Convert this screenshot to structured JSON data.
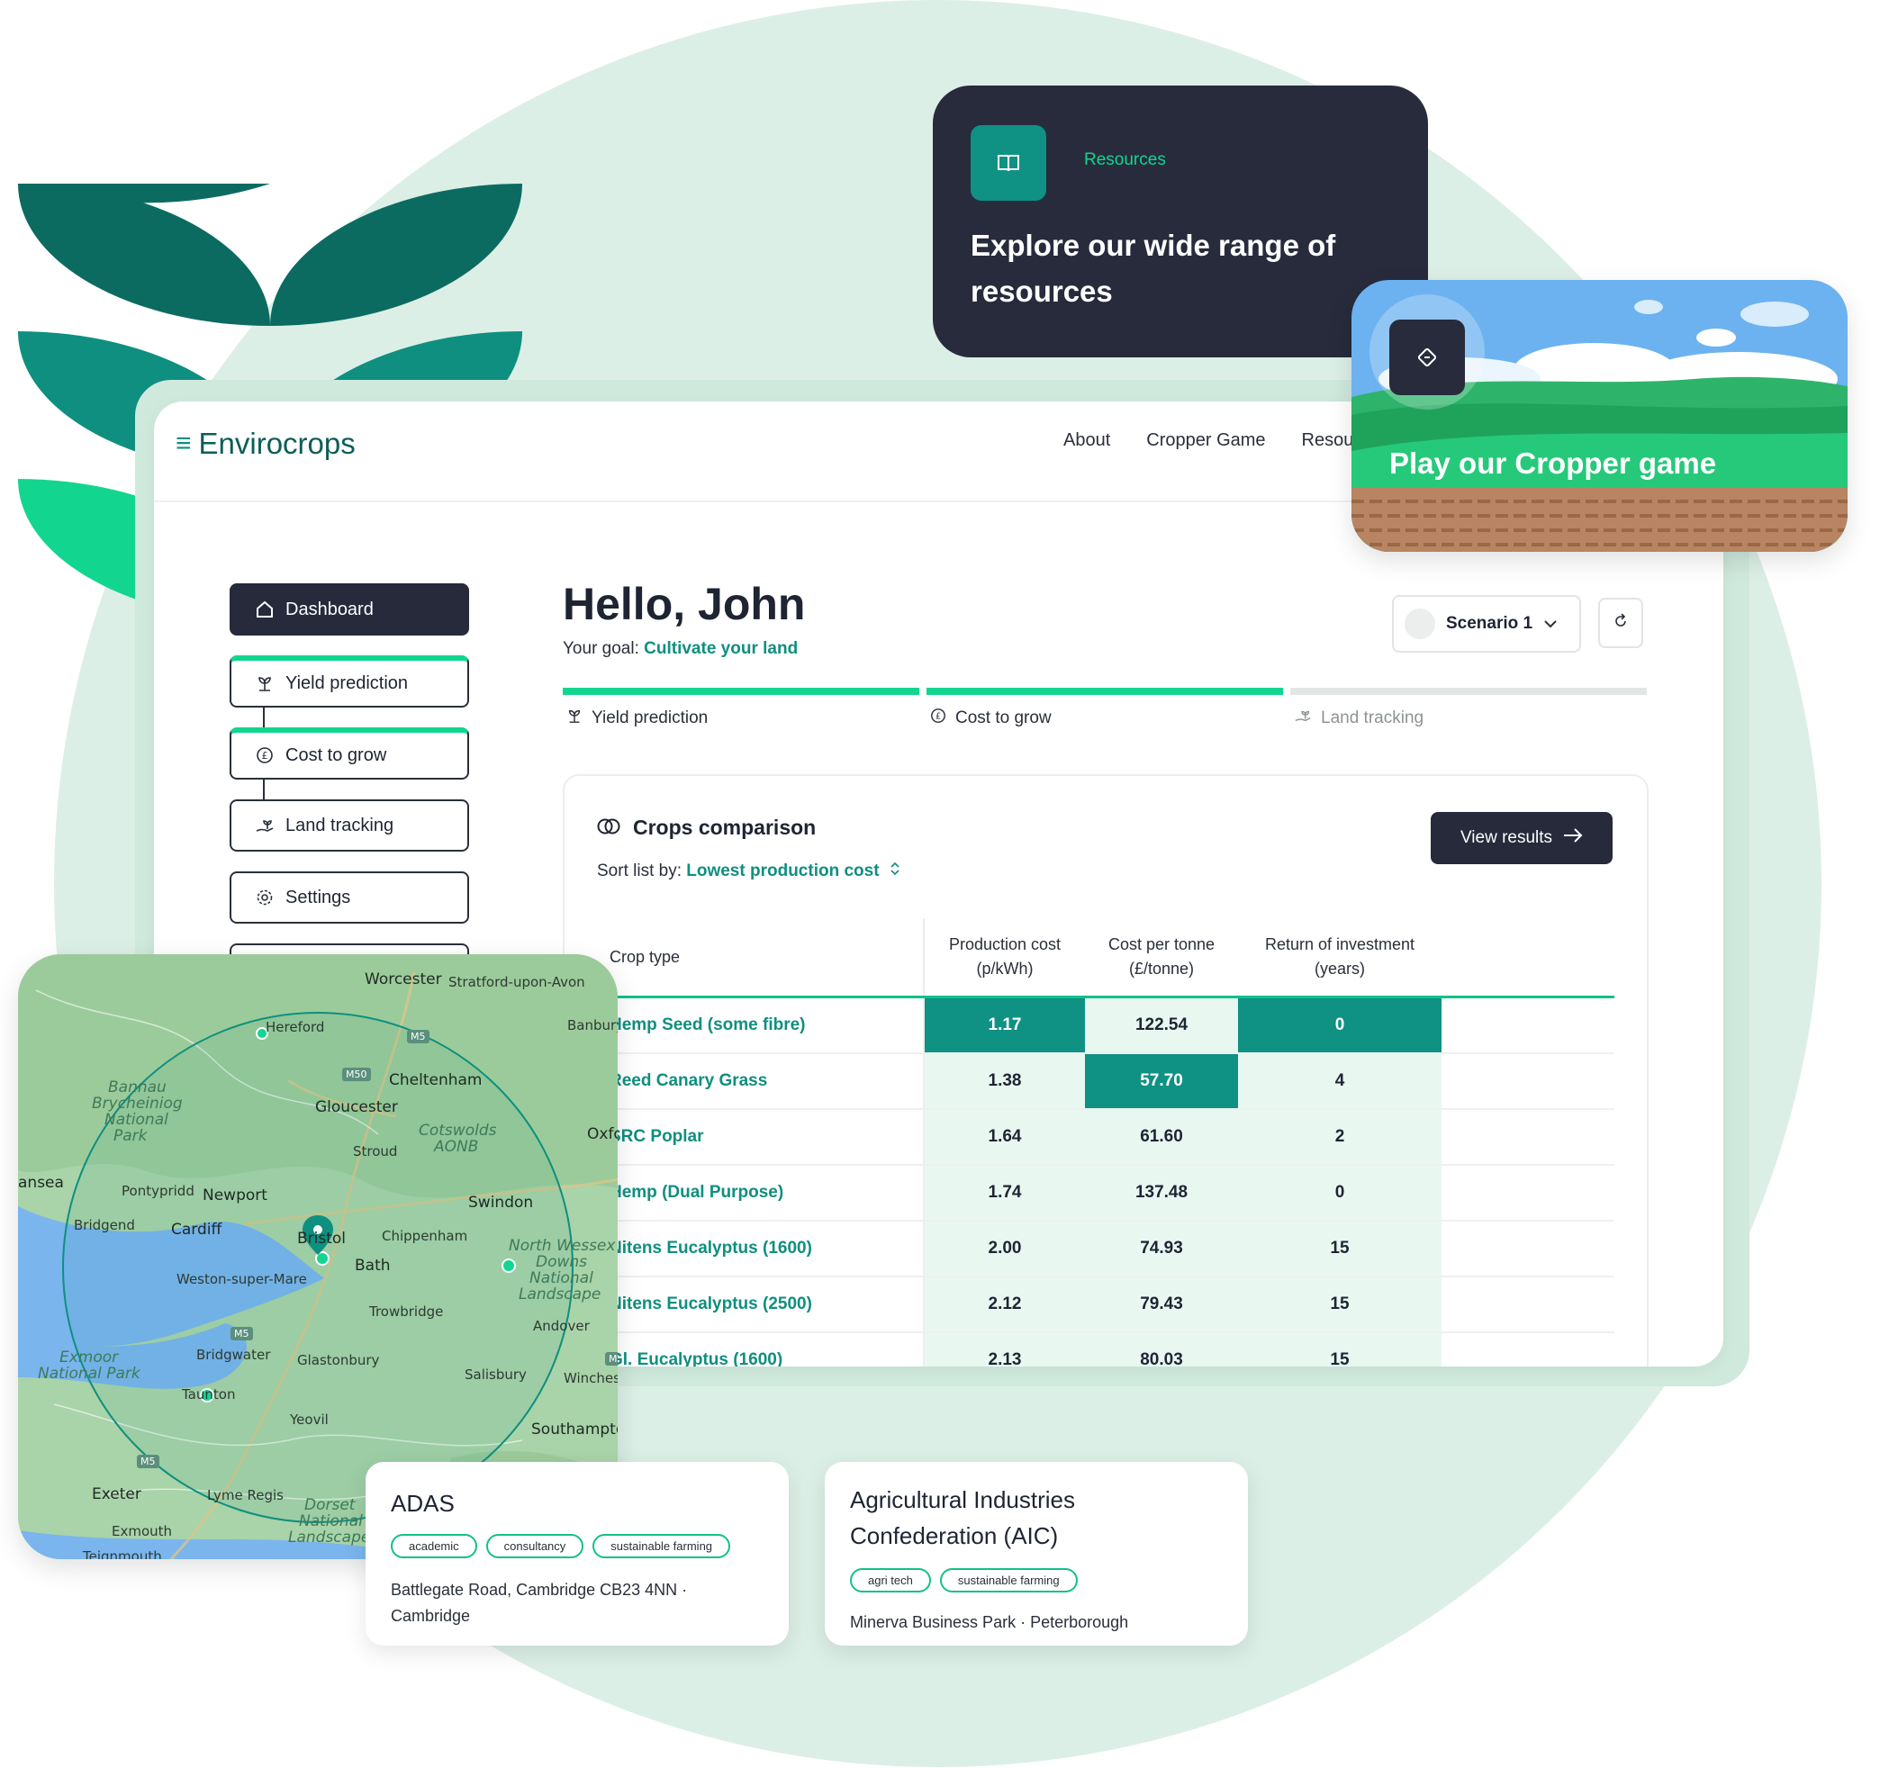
{
  "brand": {
    "name": "Envirocrops",
    "mark": "≡"
  },
  "nav": {
    "about": "About",
    "cropper_game": "Cropper Game",
    "resources": "Resou"
  },
  "sidebar": {
    "items": [
      {
        "label": "Dashboard",
        "icon": "home-icon"
      },
      {
        "label": "Yield prediction",
        "icon": "sprout-icon"
      },
      {
        "label": "Cost to grow",
        "icon": "pound-icon"
      },
      {
        "label": "Land tracking",
        "icon": "hand-plant-icon"
      },
      {
        "label": "Settings",
        "icon": "gear-icon"
      }
    ]
  },
  "greeting": {
    "title": "Hello, John",
    "goal_prefix": "Your goal: ",
    "goal_link": "Cultivate your land"
  },
  "scenario": {
    "label": "Scenario 1"
  },
  "progress": {
    "steps": [
      {
        "label": "Yield prediction",
        "complete": true
      },
      {
        "label": "Cost to grow",
        "complete": true
      },
      {
        "label": "Land tracking",
        "complete": false
      }
    ]
  },
  "comparison": {
    "title": "Crops comparison",
    "sort_prefix": "Sort list by: ",
    "sort_value": "Lowest production cost",
    "view_button": "View results",
    "headers": {
      "crop": "Crop type",
      "production_1": "Production cost",
      "production_2": "(p/kWh)",
      "tonne_1": "Cost per tonne",
      "tonne_2": "(£/tonne)",
      "roi_1": "Return of investment",
      "roi_2": "(years)"
    },
    "rows": [
      {
        "name": "Hemp Seed (some fibre)",
        "production": "1.17",
        "tonne": "122.54",
        "roi": "0"
      },
      {
        "name": "Reed Canary Grass",
        "production": "1.38",
        "tonne": "57.70",
        "roi": "4"
      },
      {
        "name": "SRC Poplar",
        "production": "1.64",
        "tonne": "61.60",
        "roi": "2"
      },
      {
        "name": "Hemp (Dual Purpose)",
        "production": "1.74",
        "tonne": "137.48",
        "roi": "0"
      },
      {
        "name": "Nitens Eucalyptus (1600)",
        "production": "2.00",
        "tonne": "74.93",
        "roi": "15"
      },
      {
        "name": "Nitens Eucalyptus (2500)",
        "production": "2.12",
        "tonne": "79.43",
        "roi": "15"
      },
      {
        "name": "Gl. Eucalyptus (1600)",
        "production": "2.13",
        "tonne": "80.03",
        "roi": "15"
      }
    ]
  },
  "resources_card": {
    "label": "Resources",
    "title": "Explore our wide range of resources",
    "icon": "book-icon"
  },
  "game_card": {
    "title": "Play our Cropper game",
    "icon": "ticket-icon"
  },
  "map": {
    "labels": {
      "worcester": "Worcester",
      "stratford": "Stratford-upon-Avon",
      "hereford": "Hereford",
      "banbury": "Banbury",
      "cheltenham": "Cheltenham",
      "gloucester": "Gloucester",
      "cotswolds_1": "Cotswolds",
      "cotswolds_2": "AONB",
      "stroud": "Stroud",
      "oxford": "Oxfo",
      "bannau_1": "Bannau",
      "bannau_2": "Brycheiniog",
      "bannau_3": "National",
      "bannau_4": "Park",
      "swansea": "ansea",
      "pontypridd": "Pontypridd",
      "newport": "Newport",
      "swindon": "Swindon",
      "bridgend": "Bridgend",
      "cardiff": "Cardiff",
      "bristol": "Bristol",
      "chippenham": "Chippenham",
      "wessex_1": "North Wessex",
      "wessex_2": "Downs",
      "wessex_3": "National",
      "wessex_4": "Landscape",
      "bath": "Bath",
      "weston": "Weston-super-Mare",
      "trowbridge": "Trowbridge",
      "andover": "Andover",
      "exmoor_1": "Exmoor",
      "exmoor_2": "National Park",
      "bridgwater": "Bridgwater",
      "glastonbury": "Glastonbury",
      "salisbury": "Salisbury",
      "winchester": "Winches",
      "taunton": "Taunton",
      "yeovil": "Yeovil",
      "southampton": "Southampto",
      "exeter": "Exeter",
      "lyme": "Lyme Regis",
      "dorset_1": "Dorset",
      "dorset_2": "National",
      "dorset_3": "Landscape",
      "exmouth": "Exmouth",
      "teignmouth": "Teignmouth"
    },
    "roads": {
      "m5_a": "M5",
      "m50": "M50",
      "m5_b": "M5",
      "m5_c": "M5",
      "m4": "M"
    }
  },
  "orgs": [
    {
      "name_1": "ADAS",
      "name_2": "",
      "tags": [
        "academic",
        "consultancy",
        "sustainable farming"
      ],
      "address_1": "Battlegate Road, Cambridge CB23 4NN ·",
      "address_2": "Cambridge"
    },
    {
      "name_1": "Agricultural Industries",
      "name_2": "Confederation (AIC)",
      "tags": [
        "agri tech",
        "sustainable farming"
      ],
      "address_1": "Minerva Business Park · Peterborough",
      "address_2": ""
    }
  ],
  "colors": {
    "dark": "#262a3b",
    "teal": "#0f9184",
    "accent": "#12d68f",
    "link": "#0f8f7f"
  }
}
